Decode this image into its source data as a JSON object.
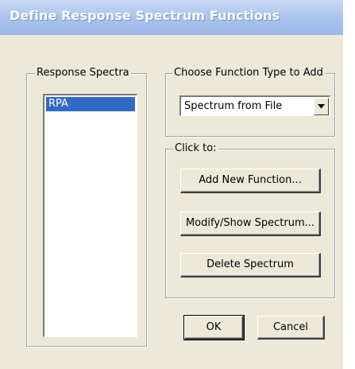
{
  "window": {
    "title": "Define Response Spectrum Functions"
  },
  "response_spectra": {
    "label": "Response Spectra",
    "items": [
      "RPA"
    ],
    "selected": "RPA"
  },
  "function_type": {
    "label": "Choose  Function Type to Add",
    "selected_value": "Spectrum from File"
  },
  "click_to": {
    "label": "Click to:",
    "add_label": "Add New Function...",
    "modify_label": "Modify/Show Spectrum...",
    "delete_label": "Delete Spectrum"
  },
  "footer": {
    "ok_label": "OK",
    "cancel_label": "Cancel"
  }
}
